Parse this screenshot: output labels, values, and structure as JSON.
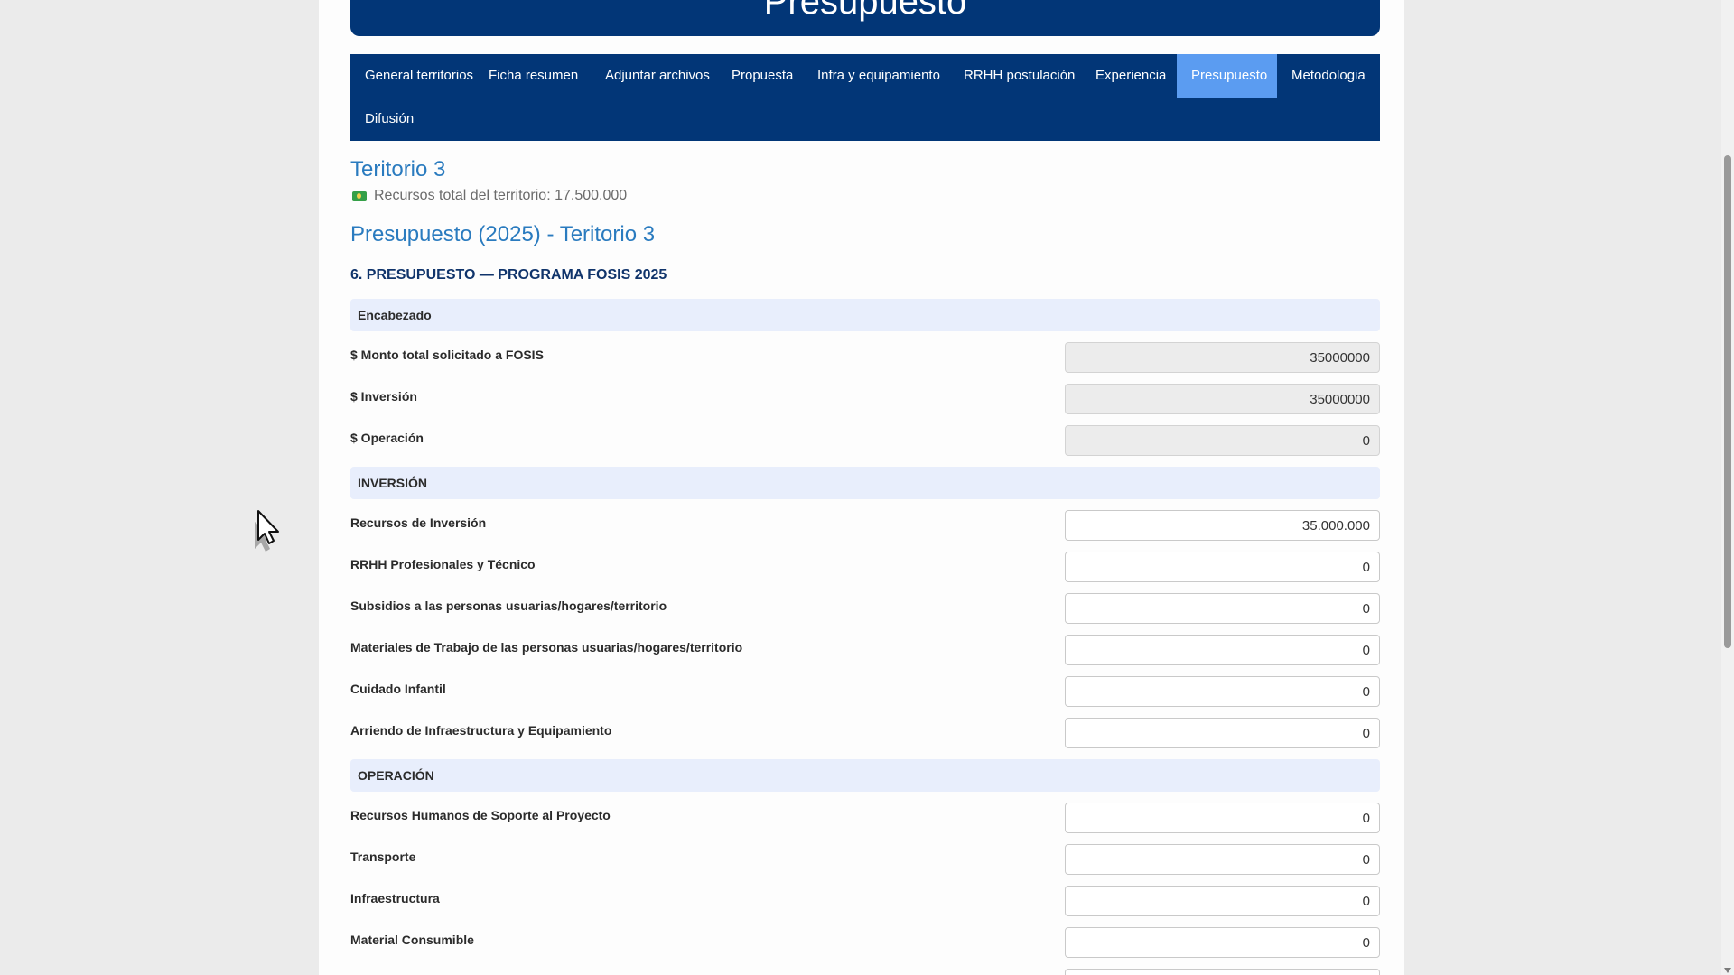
{
  "header": {
    "title": "Presupuesto"
  },
  "tabs": [
    {
      "label": "General territorios",
      "active": false
    },
    {
      "label": "Ficha resumen",
      "active": false
    },
    {
      "label": "Adjuntar archivos",
      "active": false
    },
    {
      "label": "Propuesta",
      "active": false
    },
    {
      "label": "Infra y equipamiento",
      "active": false
    },
    {
      "label": "RRHH postulación",
      "active": false
    },
    {
      "label": "Experiencia",
      "active": false
    },
    {
      "label": "Presupuesto",
      "active": true
    },
    {
      "label": "Metodologia",
      "active": false
    },
    {
      "label": "Difusión",
      "active": false
    }
  ],
  "territorio": {
    "title": "Teritorio 3",
    "recursos": "Recursos total del territorio: 17.500.000",
    "icon": "money-icon"
  },
  "presupuesto": {
    "title": "Presupuesto (2025) - Teritorio 3",
    "section_heading": "6. PRESUPUESTO — PROGRAMA FOSIS 2025"
  },
  "encabezado": {
    "label": "Encabezado",
    "rows": [
      {
        "label": "$ Monto total solicitado a FOSIS",
        "value": "35000000"
      },
      {
        "label": "$ Inversión",
        "value": "35000000"
      },
      {
        "label": "$ Operación",
        "value": "0"
      }
    ]
  },
  "inversion": {
    "label": "INVERSIÓN",
    "rows": [
      {
        "label": "Recursos de Inversión",
        "value": "35.000.000"
      },
      {
        "label": "RRHH Profesionales y Técnico",
        "value": "0"
      },
      {
        "label": "Subsidios a las personas usuarias/hogares/territorio",
        "value": "0"
      },
      {
        "label": "Materiales de Trabajo de las personas usuarias/hogares/territorio",
        "value": "0"
      },
      {
        "label": "Cuidado Infantil",
        "value": "0"
      },
      {
        "label": "Arriendo de Infraestructura y Equipamiento",
        "value": "0"
      }
    ]
  },
  "operacion": {
    "label": "OPERACIÓN",
    "rows": [
      {
        "label": "Recursos Humanos de Soporte al Proyecto",
        "value": "0"
      },
      {
        "label": "Transporte",
        "value": "0"
      },
      {
        "label": "Infraestructura",
        "value": "0"
      },
      {
        "label": "Material Consumible",
        "value": "0"
      }
    ]
  },
  "colors": {
    "navy": "#023677",
    "active_tab": "#5b9cf1",
    "link_blue": "#2a7bbf",
    "band": "#e8eefc"
  }
}
